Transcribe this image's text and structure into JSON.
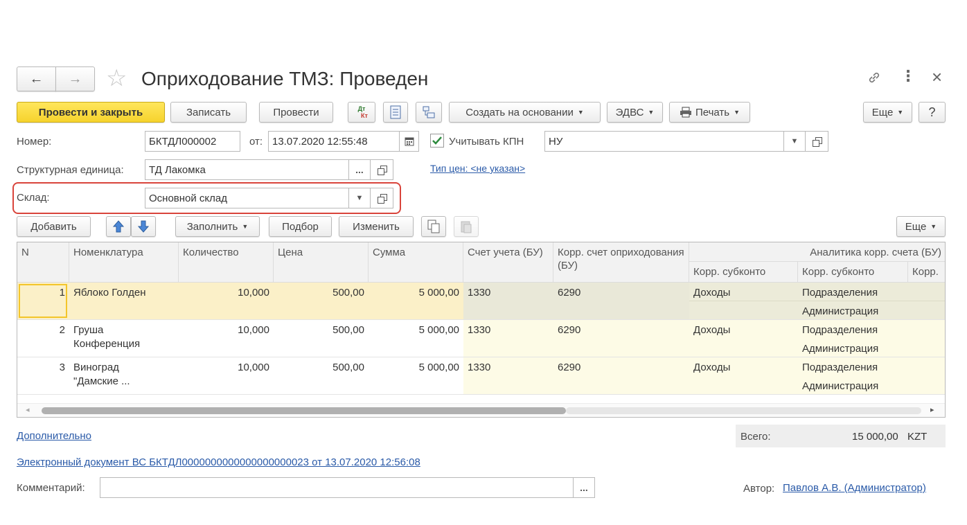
{
  "window": {
    "title": "Оприходование ТМЗ: Проведен",
    "nav_back": "←",
    "nav_forward": "→",
    "star": "☆",
    "link_icon": "🔗",
    "more_icon": "⋮",
    "close_icon": "×"
  },
  "toolbar": {
    "post_close": "Провести и закрыть",
    "save": "Записать",
    "post": "Провести",
    "dt_kt_top": "Дт",
    "dt_kt_bottom": "Кт",
    "create_based": "Создать на основании",
    "edvs": "ЭДВС",
    "print": "Печать",
    "more": "Еще",
    "help": "?"
  },
  "form": {
    "number_label": "Номер:",
    "number_value": "БКТДЛ000002",
    "date_label": "от:",
    "date_value": "13.07.2020 12:55:48",
    "kpn_label": "Учитывать КПН",
    "kpn_checked": true,
    "tax_value": "НУ",
    "unit_label": "Структурная единица:",
    "unit_value": "ТД Лакомка",
    "price_type_link": "Тип цен: <не указан>",
    "warehouse_label": "Склад:",
    "warehouse_value": "Основной склад",
    "ellipsis": "..."
  },
  "table_toolbar": {
    "add": "Добавить",
    "fill": "Заполнить",
    "pick": "Подбор",
    "change": "Изменить",
    "more": "Еще"
  },
  "table": {
    "headers": {
      "n": "N",
      "item": "Номенклатура",
      "qty": "Количество",
      "price": "Цена",
      "sum": "Сумма",
      "account": "Счет учета (БУ)",
      "corr_account": "Корр. счет оприходования (БУ)",
      "analytics": "Аналитика корр. счета (БУ)",
      "sub1": "Корр. субконто",
      "sub2": "Корр. субконто",
      "sub3": "Корр."
    },
    "rows": [
      {
        "n": "1",
        "item": "Яблоко Голден",
        "item2": "",
        "qty": "10,000",
        "price": "500,00",
        "sum": "5 000,00",
        "account": "1330",
        "corr": "6290",
        "s1": "Доходы",
        "s2a": "Подразделения",
        "s2b": "Администрация"
      },
      {
        "n": "2",
        "item": "Груша",
        "item2": "Конференция",
        "qty": "10,000",
        "price": "500,00",
        "sum": "5 000,00",
        "account": "1330",
        "corr": "6290",
        "s1": "Доходы",
        "s2a": "Подразделения",
        "s2b": "Администрация"
      },
      {
        "n": "3",
        "item": "Виноград",
        "item2": "\"Дамские ...",
        "qty": "10,000",
        "price": "500,00",
        "sum": "5 000,00",
        "account": "1330",
        "corr": "6290",
        "s1": "Доходы",
        "s2a": "Подразделения",
        "s2b": "Администрация"
      }
    ],
    "scroll_left": "◂",
    "scroll_right": "▸"
  },
  "footer": {
    "additional_link": "Дополнительно",
    "total_label": "Всего:",
    "total_value": "15 000,00",
    "currency": "KZT",
    "edoc_link": "Электронный документ ВС БКТДЛ0000000000000000000023 от 13.07.2020 12:56:08",
    "comment_label": "Комментарий:",
    "comment_value": "",
    "author_label": "Автор:",
    "author_link": "Павлов А.В. (Администратор)"
  },
  "colors": {
    "accent_yellow": "#f6d32d",
    "highlight_red": "#d9443b",
    "link_blue": "#2a5aa8",
    "row_selected": "#fbf0c8",
    "row_cream": "#fdfbe6"
  }
}
